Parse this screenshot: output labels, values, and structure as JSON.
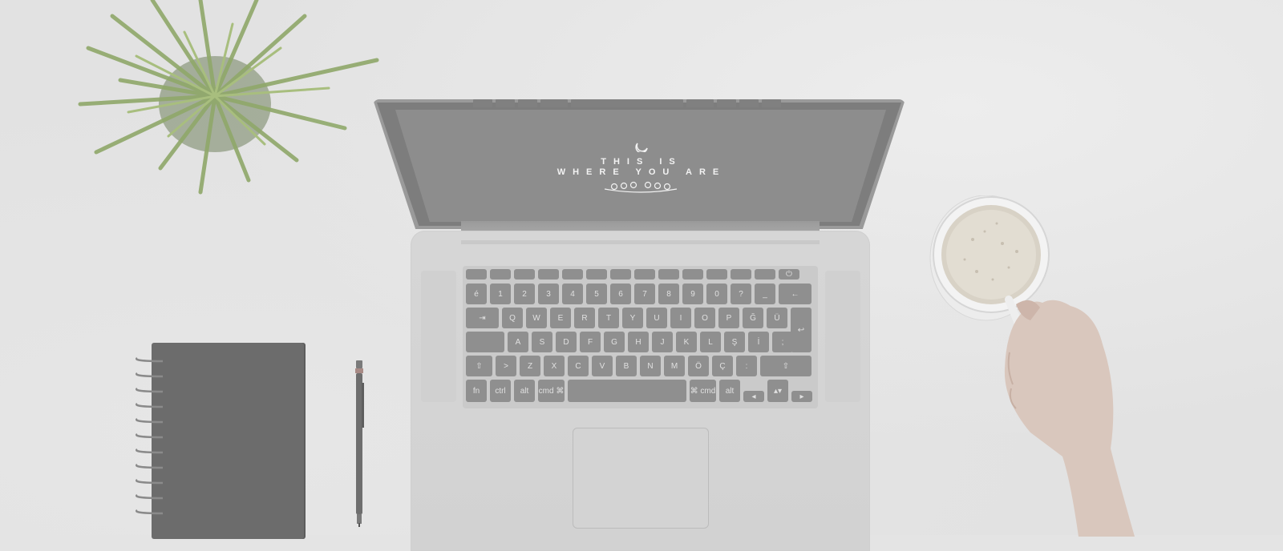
{
  "screen": {
    "line1": "THIS IS",
    "line2": "WHERE YOU ARE"
  },
  "objects": [
    "plant-icon",
    "laptop-icon",
    "notebook-icon",
    "pen-icon",
    "coffee-cup-icon",
    "hand-icon"
  ],
  "keyboard": {
    "row_numbers": [
      "é",
      "!",
      "'",
      "^ #",
      "+",
      "%",
      "&",
      "/",
      "(",
      ")",
      "=",
      "?",
      "_",
      "←"
    ],
    "row_numbers_sub": [
      "\"",
      "1",
      "2",
      "3",
      "4",
      "5",
      "6",
      "7",
      "8",
      "9",
      "0",
      "*",
      "-",
      ""
    ],
    "row_q": [
      "⇥",
      "Q",
      "W",
      "E",
      "R",
      "T",
      "Y",
      "U",
      "I",
      "O",
      "P",
      "Ğ",
      "Ü",
      "↩"
    ],
    "row_a": [
      "",
      "A",
      "S",
      "D",
      "F",
      "G",
      "H",
      "J",
      "K",
      "L",
      "Ş",
      "İ",
      ";"
    ],
    "row_z": [
      "⇧",
      ">",
      "Z",
      "X",
      "C",
      "V",
      "B",
      "N",
      "M",
      "Ö",
      "Ç",
      ":",
      "⇧"
    ],
    "row_bottom": [
      "fn",
      "ctrl",
      "alt",
      "cmd ⌘",
      "",
      "⌘ cmd",
      "alt",
      "◂",
      "▴▾",
      "▸"
    ]
  },
  "colors": {
    "desk": "#e2e2e2",
    "laptop_body": "#d4d4d4",
    "keys": "#8f8f8f",
    "notebook": "#6c6c6c",
    "plant": "#8fa86a"
  }
}
